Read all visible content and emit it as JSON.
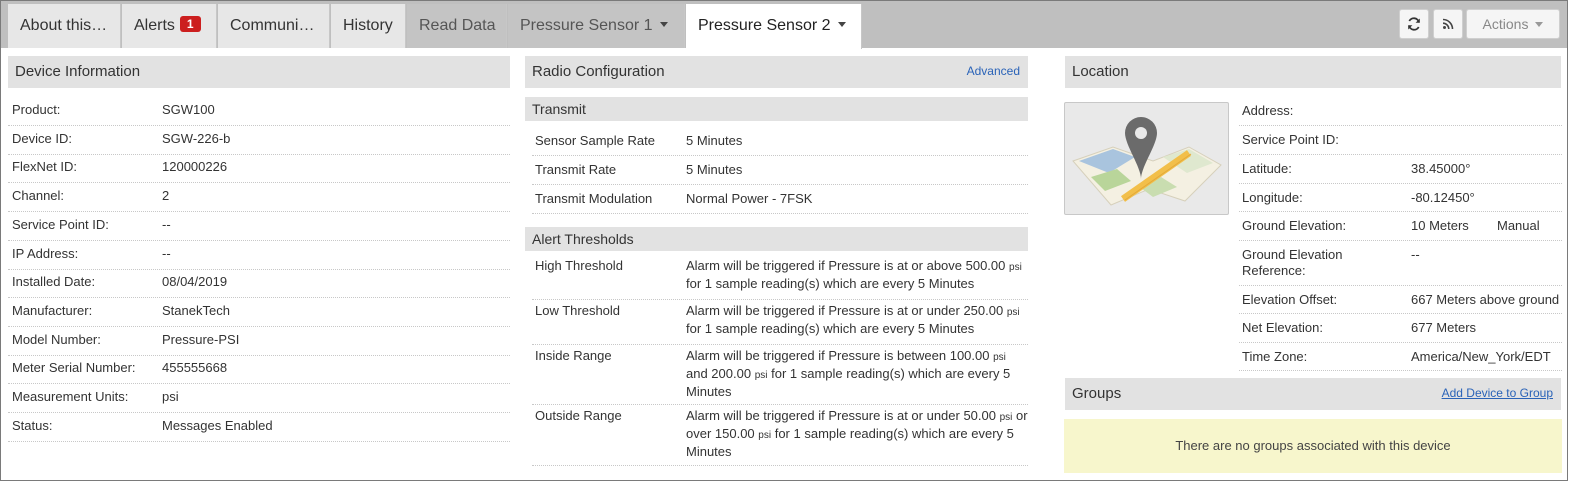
{
  "tabs": [
    {
      "label": "About this…"
    },
    {
      "label": "Alerts",
      "badge": "1"
    },
    {
      "label": "Communi…"
    },
    {
      "label": "History"
    },
    {
      "label": "Read Data"
    },
    {
      "label": "Pressure Sensor 1"
    },
    {
      "label": "Pressure Sensor 2"
    }
  ],
  "toolbar": {
    "actions_label": "Actions"
  },
  "device_info": {
    "title": "Device Information",
    "rows": [
      {
        "label": "Product:",
        "value": "SGW100"
      },
      {
        "label": "Device ID:",
        "value": "SGW-226-b"
      },
      {
        "label": "FlexNet ID:",
        "value": "120000226"
      },
      {
        "label": "Channel:",
        "value": "2"
      },
      {
        "label": "Service Point ID:",
        "value": "--"
      },
      {
        "label": "IP Address:",
        "value": "--"
      },
      {
        "label": "Installed Date:",
        "value": "08/04/2019"
      },
      {
        "label": "Manufacturer:",
        "value": "StanekTech"
      },
      {
        "label": "Model Number:",
        "value": "Pressure-PSI"
      },
      {
        "label": "Meter Serial Number:",
        "value": "455555668"
      },
      {
        "label": "Measurement Units:",
        "value": "psi"
      },
      {
        "label": "Status:",
        "value": "Messages Enabled"
      }
    ]
  },
  "radio": {
    "title": "Radio Configuration",
    "advanced_label": "Advanced",
    "transmit_title": "Transmit",
    "transmit_rows": [
      {
        "label": "Sensor Sample Rate",
        "value": "5 Minutes"
      },
      {
        "label": "Transmit Rate",
        "value": "5 Minutes"
      },
      {
        "label": "Transmit Modulation",
        "value": "Normal Power - 7FSK"
      }
    ],
    "alert_title": "Alert Thresholds",
    "thresholds": [
      {
        "label": "High Threshold",
        "t1": "Alarm will be triggered if Pressure is at or above 500.00",
        "u1": "psi",
        "t2": "for 1 sample reading(s) which are every 5 Minutes"
      },
      {
        "label": "Low Threshold",
        "t1": "Alarm will be triggered if Pressure is at or under 250.00",
        "u1": "psi",
        "t2": "for 1 sample reading(s) which are every 5 Minutes"
      },
      {
        "label": "Inside Range",
        "t1": "Alarm will be triggered if Pressure is between 100.00",
        "u1": "psi",
        "t2": "and 200.00",
        "u2": "psi",
        "t3": "for 1 sample reading(s) which are every 5 Minutes"
      },
      {
        "label": "Outside Range",
        "t1": "Alarm will be triggered if Pressure is at or under 50.00",
        "u1": "psi",
        "t2": "or over 150.00",
        "u2": "psi",
        "t3": "for 1 sample reading(s) which are every 5 Minutes"
      }
    ]
  },
  "location": {
    "title": "Location",
    "rows": [
      {
        "label": "Address:",
        "value": ""
      },
      {
        "label": "Service Point ID:",
        "value": ""
      },
      {
        "label": "Latitude:",
        "value": "38.45000°"
      },
      {
        "label": "Longitude:",
        "value": "-80.12450°"
      },
      {
        "label": "Ground Elevation:",
        "value": "10 Meters",
        "extra": "Manual"
      },
      {
        "label": "Ground Elevation Reference:",
        "value": "--"
      },
      {
        "label": "Elevation Offset:",
        "value": "667 Meters above ground"
      },
      {
        "label": "Net Elevation:",
        "value": "677 Meters"
      },
      {
        "label": "Time Zone:",
        "value": "America/New_York/EDT"
      }
    ]
  },
  "groups": {
    "title": "Groups",
    "add_label": "Add Device to Group",
    "empty_text": "There are no groups associated with this device"
  }
}
